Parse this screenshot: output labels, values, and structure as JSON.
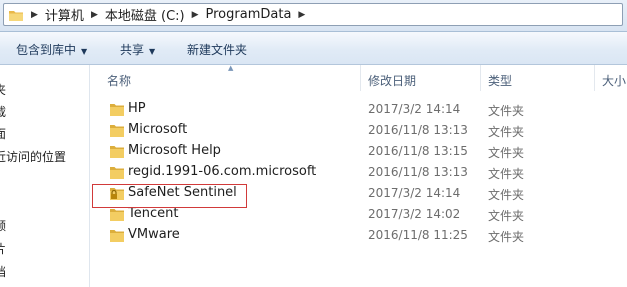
{
  "address_bar": {
    "crumbs": [
      "计算机",
      "本地磁盘 (C:)",
      "ProgramData"
    ]
  },
  "toolbar": {
    "include_label": "包含到库中",
    "share_label": "共享",
    "new_folder_label": "新建文件夹"
  },
  "nav_pane": {
    "items": [
      "夹",
      "载",
      "面",
      "近访问的位置",
      "频",
      "片",
      "档"
    ]
  },
  "columns": {
    "name": "名称",
    "date": "修改日期",
    "type": "类型",
    "size": "大小"
  },
  "files": [
    {
      "name": "HP",
      "date": "2017/3/2 14:14",
      "type": "文件夹",
      "icon": "folder-icon"
    },
    {
      "name": "Microsoft",
      "date": "2016/11/8 13:13",
      "type": "文件夹",
      "icon": "folder-icon"
    },
    {
      "name": "Microsoft Help",
      "date": "2016/11/8 13:15",
      "type": "文件夹",
      "icon": "folder-icon"
    },
    {
      "name": "regid.1991-06.com.microsoft",
      "date": "2016/11/8 13:13",
      "type": "文件夹",
      "icon": "folder-icon"
    },
    {
      "name": "SafeNet Sentinel",
      "date": "2017/3/2 14:14",
      "type": "文件夹",
      "icon": "locked-folder-icon"
    },
    {
      "name": "Tencent",
      "date": "2017/3/2 14:02",
      "type": "文件夹",
      "icon": "folder-icon"
    },
    {
      "name": "VMware",
      "date": "2016/11/8 11:25",
      "type": "文件夹",
      "icon": "folder-icon"
    }
  ],
  "colors": {
    "highlight_border": "#d13a3a",
    "folder_fill": "#f3cd62"
  }
}
